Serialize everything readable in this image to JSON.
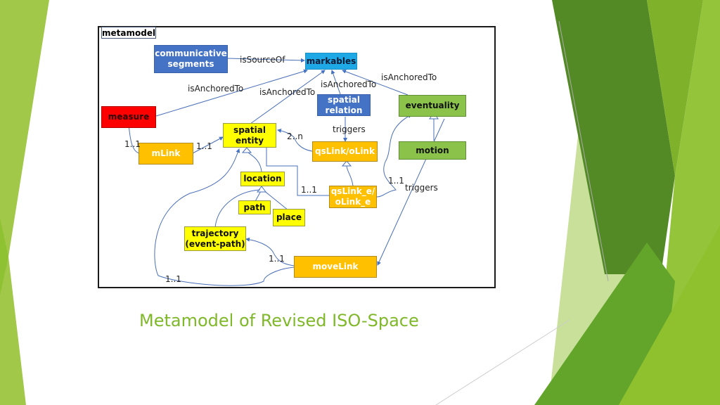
{
  "slide": {
    "caption": "Metamodel of Revised ISO-Space",
    "accent_color": "#7fb829"
  },
  "diagram": {
    "tag": "metamodel",
    "nodes": {
      "communicative_segments": "communicative segments",
      "markables": "markables",
      "spatial_relation": "spatial relation",
      "eventuality": "eventuality",
      "measure": "measure",
      "spatial_entity": "spatial entity",
      "qslink_olink": "qsLink/oLink",
      "motion": "motion",
      "mlink": "mLink",
      "location": "location",
      "qslink_e": "qsLink_e/ oLink_e",
      "path": "path",
      "place": "place",
      "trajectory": "trajectory (event-path)",
      "movelink": "moveLink"
    },
    "edge_labels": {
      "is_source_of": "isSourceOf",
      "anchored_eventuality": "isAnchoredTo",
      "anchored_spatial_relation": "isAnchoredTo",
      "anchored_measure": "isAnchoredTo",
      "anchored_spatial_entity": "isAnchoredTo",
      "triggers_qslink": "triggers",
      "two_n": "2..n",
      "measure_mlink": "1..1",
      "mlink_entity": "1..1",
      "qslink_e_entity": "1..1",
      "qslink_e_eventuality": "1..1",
      "triggers_movelink": "triggers",
      "movelink_trajectory": "1..1",
      "movelink_entity": "1..1"
    }
  }
}
